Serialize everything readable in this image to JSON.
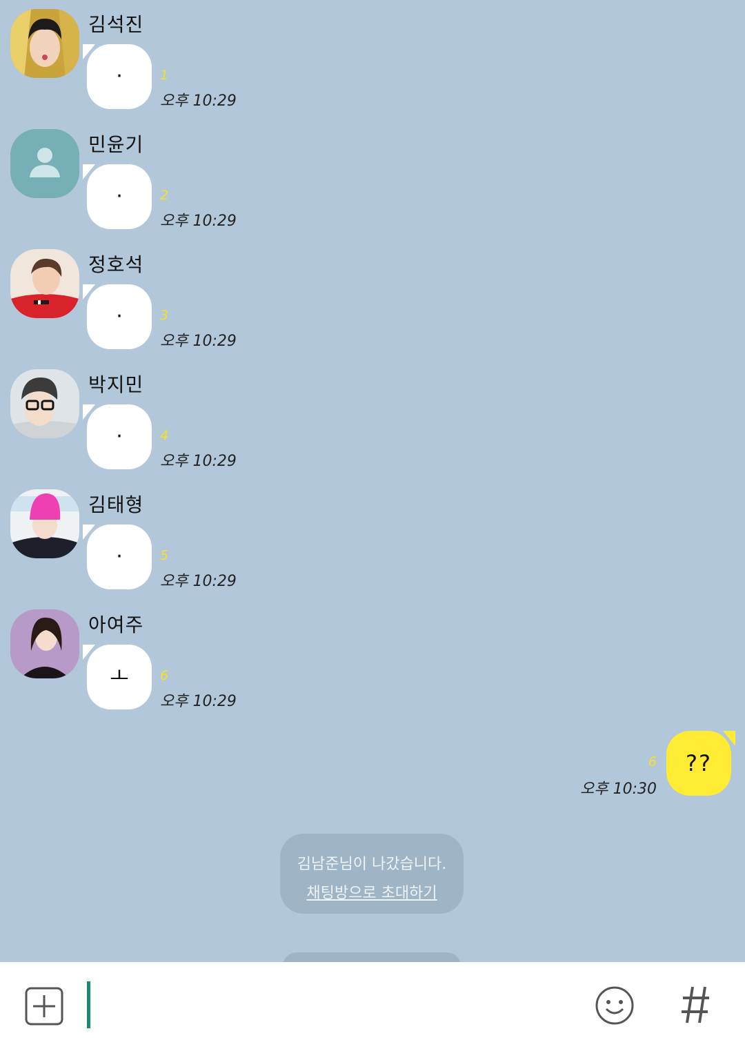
{
  "colors": {
    "background": "#b2c7d9",
    "my_bubble": "#ffeb33",
    "unread": "#f5e02b",
    "caret": "#1e8a73"
  },
  "messages": [
    {
      "sender": "김석진",
      "text": "·",
      "unread": "1",
      "time": "오후 10:29",
      "avatar": "photo-avatar"
    },
    {
      "sender": "민윤기",
      "text": "·",
      "unread": "2",
      "time": "오후 10:29",
      "avatar": "default-person-avatar"
    },
    {
      "sender": "정호석",
      "text": "·",
      "unread": "3",
      "time": "오후 10:29",
      "avatar": "photo-avatar"
    },
    {
      "sender": "박지민",
      "text": "·",
      "unread": "4",
      "time": "오후 10:29",
      "avatar": "photo-avatar"
    },
    {
      "sender": "김태형",
      "text": "·",
      "unread": "5",
      "time": "오후 10:29",
      "avatar": "photo-avatar"
    },
    {
      "sender": "아여주",
      "text": "ㅗ",
      "unread": "6",
      "time": "오후 10:29",
      "avatar": "photo-avatar"
    }
  ],
  "my_message": {
    "text": "??",
    "unread": "6",
    "time": "오후 10:30"
  },
  "notice": {
    "text": "김남준님이 나갔습니다.",
    "link": "채팅방으로 초대하기"
  },
  "input": {
    "value": "",
    "placeholder": ""
  },
  "toolbar": {
    "add_icon": "plus-square-icon",
    "emoji_icon": "smile-icon",
    "hash_icon": "hash-icon"
  }
}
